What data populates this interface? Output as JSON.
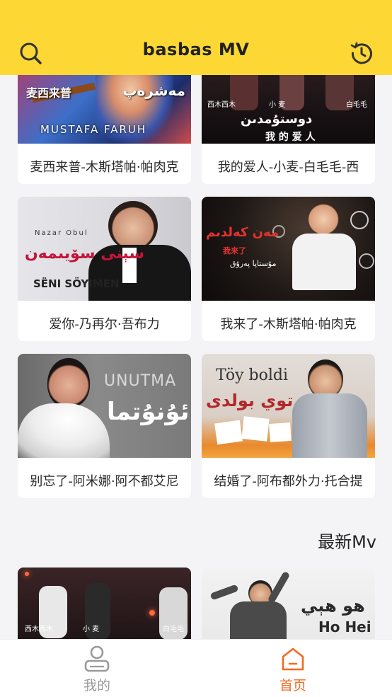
{
  "header": {
    "title": "basbas  MV",
    "background": "#fdd835",
    "left_icon": "search-icon",
    "right_icon": "history-icon"
  },
  "grid": [
    {
      "label": "麦西来普-木斯塔帕·帕肉克",
      "thumb_text": [
        "麦西来普",
        "مەشرەپ",
        "MUSTAFA FARUH"
      ]
    },
    {
      "label": "我的爱人-小麦-白毛毛-西",
      "thumb_text": [
        "西木西木",
        "小 麦",
        "白毛毛",
        "دوستۇمدىن",
        "我 的 爱 人"
      ]
    },
    {
      "label": "爱你-乃再尔·吾布力",
      "thumb_text": [
        "Nazar Obul",
        "سېنى سۆيىمەن",
        "SËNI SÖYIMEN"
      ]
    },
    {
      "label": "我来了-木斯塔帕·帕肉克",
      "thumb_text": [
        "مەن كەلدىم",
        "我来了",
        "مۇستاپا پەرۇق"
      ]
    },
    {
      "label": "别忘了-阿米娜·阿不都艾尼",
      "thumb_text": [
        "UNUTMA",
        "ئۇنۇتما"
      ]
    },
    {
      "label": "结婚了-阿布都外力·托合提",
      "thumb_text": [
        "Töy boldi",
        "توي بولدى"
      ]
    }
  ],
  "latest_section": {
    "title": "最新Mv",
    "items": [
      {
        "thumb_text": [
          "西木西木",
          "小 麦",
          "白毛毛"
        ]
      },
      {
        "thumb_text": [
          "ھو ھېي",
          "Ho Hei"
        ]
      }
    ]
  },
  "tabbar": {
    "items": [
      {
        "label": "我的",
        "icon": "user-icon",
        "active": false
      },
      {
        "label": "首页",
        "icon": "home-icon",
        "active": true
      }
    ],
    "active_color": "#f26a21",
    "inactive_color": "#9a9a9a"
  }
}
